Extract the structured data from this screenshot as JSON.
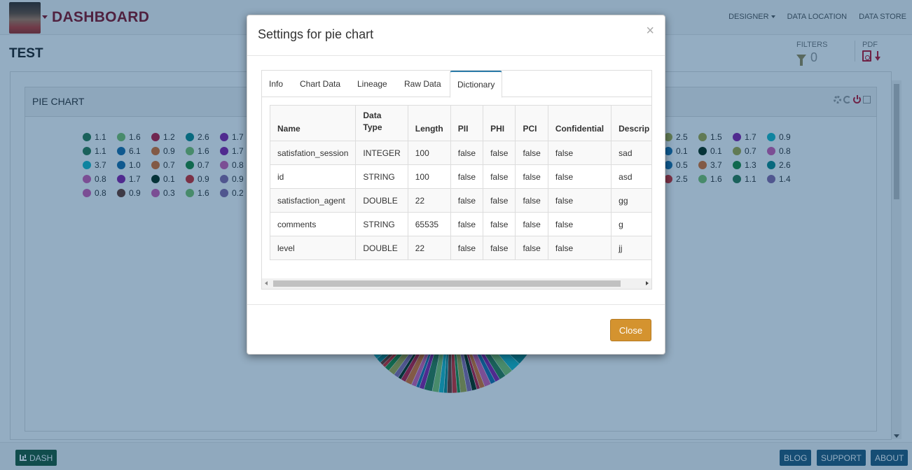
{
  "header": {
    "brand": "DASHBOARD",
    "nav": [
      {
        "label": "DESIGNER",
        "dropdown": true
      },
      {
        "label": "DATA LOCATION",
        "dropdown": false
      },
      {
        "label": "DATA STORE",
        "dropdown": false
      }
    ]
  },
  "page": {
    "title": "TEST",
    "filters_label": "FILTERS",
    "filters_count": "0",
    "pdf_label": "PDF"
  },
  "chart_panel": {
    "title": "PIE CHART",
    "legend_left": [
      [
        {
          "v": "1.1",
          "c": "#2e7d4f"
        },
        {
          "v": "1.6",
          "c": "#7cc46a"
        },
        {
          "v": "1.2",
          "c": "#c2183c"
        },
        {
          "v": "2.6",
          "c": "#0e8a8a"
        },
        {
          "v": "1.7",
          "c": "#8a1ea8"
        }
      ],
      [
        {
          "v": "1.1",
          "c": "#2e7d4f"
        },
        {
          "v": "6.1",
          "c": "#1a6fa8"
        },
        {
          "v": "0.9",
          "c": "#e0702a"
        },
        {
          "v": "1.6",
          "c": "#7cc46a"
        },
        {
          "v": "1.7",
          "c": "#8a1ea8"
        }
      ],
      [
        {
          "v": "3.7",
          "c": "#1ab8c4"
        },
        {
          "v": "1.0",
          "c": "#1a6fa8"
        },
        {
          "v": "0.7",
          "c": "#e0702a"
        },
        {
          "v": "0.7",
          "c": "#1e8a3a"
        },
        {
          "v": "0.8",
          "c": "#d45cb0"
        }
      ],
      [
        {
          "v": "0.8",
          "c": "#d45cb0"
        },
        {
          "v": "1.7",
          "c": "#8a1ea8"
        },
        {
          "v": "0.1",
          "c": "#0b2e12"
        },
        {
          "v": "0.9",
          "c": "#d42a2a"
        },
        {
          "v": "0.9",
          "c": "#8a6aa8"
        }
      ],
      [
        {
          "v": "0.8",
          "c": "#d45cb0"
        },
        {
          "v": "0.9",
          "c": "#6b3a2a"
        },
        {
          "v": "0.3",
          "c": "#d45cb0"
        },
        {
          "v": "1.6",
          "c": "#7cc46a"
        },
        {
          "v": "0.2",
          "c": "#8a6aa8"
        }
      ]
    ],
    "legend_right": [
      [
        {
          "v": "2.5",
          "c": "#a8a842"
        },
        {
          "v": "1.5",
          "c": "#a8a842"
        },
        {
          "v": "1.7",
          "c": "#8a1ea8"
        },
        {
          "v": "0.9",
          "c": "#1ab8c4"
        }
      ],
      [
        {
          "v": "0.1",
          "c": "#1a6fa8"
        },
        {
          "v": "0.1",
          "c": "#0b2e12"
        },
        {
          "v": "0.7",
          "c": "#a8a842"
        },
        {
          "v": "0.8",
          "c": "#d45cb0"
        }
      ],
      [
        {
          "v": "0.5",
          "c": "#1a6fa8"
        },
        {
          "v": "3.7",
          "c": "#e0702a"
        },
        {
          "v": "1.3",
          "c": "#1e8a3a"
        },
        {
          "v": "2.6",
          "c": "#0e8a8a"
        }
      ],
      [
        {
          "v": "2.5",
          "c": "#d42a2a"
        },
        {
          "v": "1.6",
          "c": "#7cc46a"
        },
        {
          "v": "1.1",
          "c": "#2e7d4f"
        },
        {
          "v": "1.4",
          "c": "#8a6aa8"
        }
      ]
    ]
  },
  "modal": {
    "title": "Settings for pie chart",
    "close_symbol": "×",
    "tabs": [
      "Info",
      "Chart Data",
      "Lineage",
      "Raw Data",
      "Dictionary"
    ],
    "active_tab": "Dictionary",
    "table": {
      "headers": [
        "Name",
        "Data Type",
        "Length",
        "PII",
        "PHI",
        "PCI",
        "Confidential",
        "Descrip"
      ],
      "rows": [
        [
          "satisfation_session",
          "INTEGER",
          "100",
          "false",
          "false",
          "false",
          "false",
          "sad"
        ],
        [
          "id",
          "STRING",
          "100",
          "false",
          "false",
          "false",
          "false",
          "asd"
        ],
        [
          "satisfaction_agent",
          "DOUBLE",
          "22",
          "false",
          "false",
          "false",
          "false",
          "gg"
        ],
        [
          "comments",
          "STRING",
          "65535",
          "false",
          "false",
          "false",
          "false",
          "g"
        ],
        [
          "level",
          "DOUBLE",
          "22",
          "false",
          "false",
          "false",
          "false",
          "jj"
        ]
      ]
    },
    "close_button": "Close"
  },
  "footer": {
    "dash": "DASH",
    "buttons": [
      "BLOG",
      "SUPPORT",
      "ABOUT"
    ]
  }
}
